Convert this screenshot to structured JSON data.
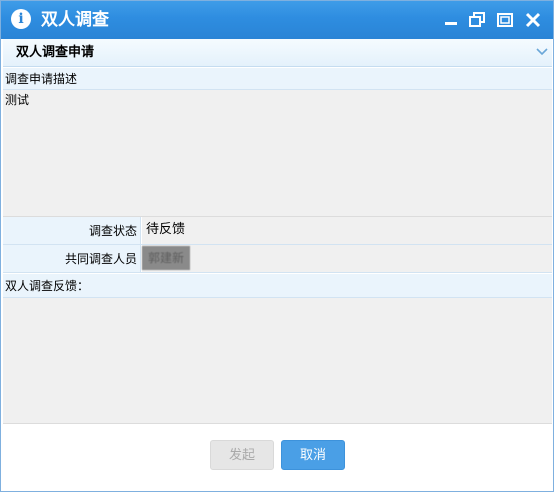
{
  "window": {
    "title": "双人调查",
    "icon": "info-icon",
    "controls": [
      "minimize-icon",
      "restore-icon",
      "maximize-icon",
      "close-icon"
    ]
  },
  "panel": {
    "title": "双人调查申请",
    "toggle_icon": "chevron-down-icon"
  },
  "description": {
    "label": "调查申请描述",
    "value": "测试"
  },
  "status": {
    "label": "调查状态",
    "value": "待反馈"
  },
  "co_investigator": {
    "label": "共同调查人员",
    "value": "郭建新"
  },
  "feedback": {
    "label": "双人调查反馈：",
    "value": ""
  },
  "buttons": {
    "submit_label": "发起",
    "cancel_label": "取消"
  },
  "colors": {
    "titlebar": "#2a84d6",
    "label_bg": "#eaf4fc",
    "field_bg": "#f0f0f0",
    "primary_button": "#4a9fe6",
    "disabled_button": "#e6e6e6"
  }
}
